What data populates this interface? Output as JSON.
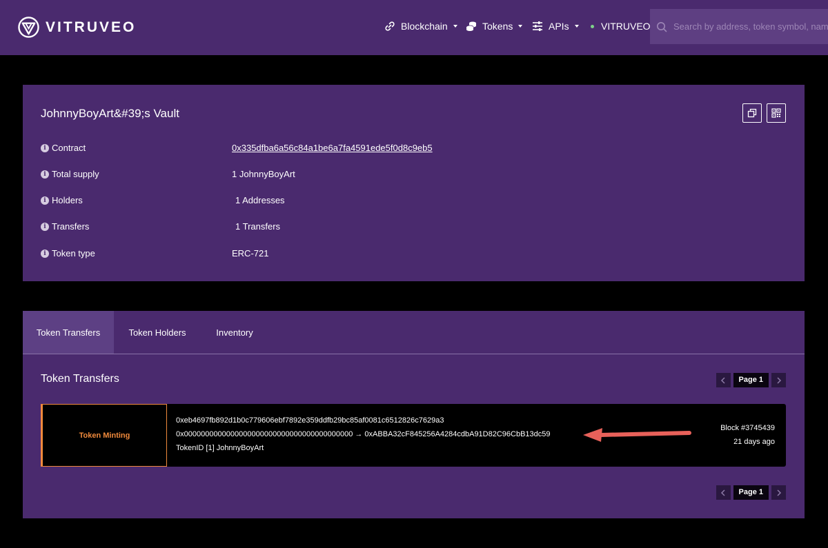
{
  "header": {
    "brand": "VITRUVEO",
    "nav": {
      "blockchain": "Blockchain",
      "tokens": "Tokens",
      "apis": "APIs",
      "network": "VITRUVEO"
    },
    "search_placeholder": "Search by address, token symbol, name, transaction hash, or block number",
    "accent_color": "#4a2a6e",
    "network_dot_color": "#7ed28a"
  },
  "token": {
    "title": "JohnnyBoyArt&#39;s Vault",
    "copy_icon": "copy-icon",
    "qr_icon": "qr-code-icon",
    "details": [
      {
        "label": "Contract",
        "value": "0x335dfba6a56c84a1be6a7fa4591ede5f0d8c9eb5"
      },
      {
        "label": "Total supply",
        "value": "1 JohnnyBoyArt"
      },
      {
        "label": "Holders",
        "value": "1 Addresses"
      },
      {
        "label": "Transfers",
        "value": "1 Transfers"
      },
      {
        "label": "Token type",
        "value": "ERC-721"
      }
    ]
  },
  "transfers": {
    "tabs": [
      "Token Transfers",
      "Token Holders",
      "Inventory"
    ],
    "active_tab": "Token Transfers",
    "section_title": "Token Transfers",
    "pager_label": "Page 1",
    "items": [
      {
        "type": "Token Minting",
        "tx_hash": "0xeb4697fb892d1b0c779606ebf7892e359ddfb29bc85af0081c6512826c7629a3",
        "from_to": "0x0000000000000000000000000000000000000000 → 0xABBA32cF845256A4284cdbA91D82C96CbB13dc59",
        "token_id": "TokenID [1] JohnnyBoyArt",
        "block": "Block #3745439",
        "age": "21 days ago"
      }
    ],
    "type_color": "#f08a3c",
    "annotation_arrow_color": "#e8615a"
  }
}
